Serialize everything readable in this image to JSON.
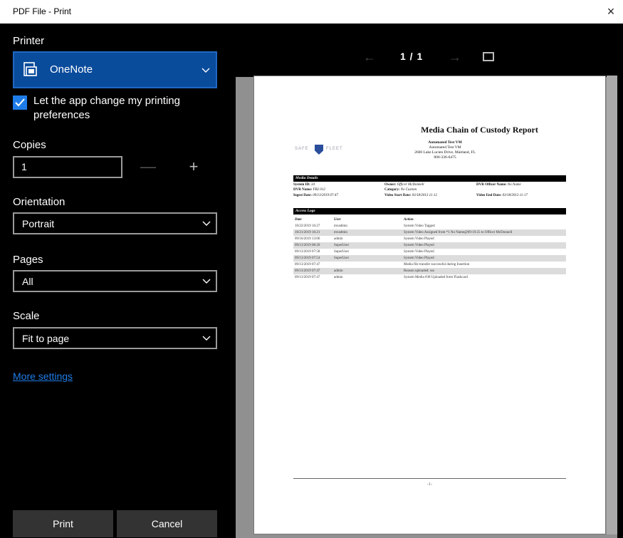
{
  "window": {
    "title": "PDF File - Print",
    "close_glyph": "×"
  },
  "printer": {
    "section_label": "Printer",
    "selected": "OneNote",
    "icon": "onenote-printer-icon",
    "accent": "#0a4c9c"
  },
  "app_prefs": {
    "checked": true,
    "label": "Let the app change my printing preferences"
  },
  "copies": {
    "label": "Copies",
    "value": "1",
    "minus": "—",
    "plus": "+"
  },
  "orientation": {
    "label": "Orientation",
    "selected": "Portrait"
  },
  "pages": {
    "label": "Pages",
    "selected": "All"
  },
  "scale": {
    "label": "Scale",
    "selected": "Fit to page"
  },
  "more_settings": "More settings",
  "buttons": {
    "print": "Print",
    "cancel": "Cancel"
  },
  "preview": {
    "prev_glyph": "←",
    "page_counter": "1 / 1",
    "next_glyph": "→",
    "fit_icon": "fit-page-icon"
  },
  "report": {
    "title": "Media Chain of Custody Report",
    "logo_left": "SAFE",
    "logo_right": "FLEET",
    "org_name": "Automated Test VM",
    "org_sub": "Automated Test VM",
    "org_address": "2600 Lake Lucien Drive, Maitland, FL",
    "org_phone": "800-336-6475",
    "media_details_header": "Media Details",
    "media": {
      "system_id_label": "System ID:",
      "system_id": "34",
      "owner_label": "Owner:",
      "owner": "Officer McDonnell",
      "dvr_officer_label": "DVR Officer Name:",
      "dvr_officer": "No Name",
      "dvr_name_label": "DVR Name:",
      "dvr_name": "FB2 012",
      "category_label": "Category:",
      "category": "No Custom",
      "ingest_label": "Ingest Date:",
      "ingest": "09/13/2019 07:47",
      "video_start_label": "Video Start Date:",
      "video_start": "03/18/2013 11:12",
      "video_end_label": "Video End Date:",
      "video_end": "03/18/2013 11:17"
    },
    "access_logs_header": "Access Logs",
    "columns": [
      "Date",
      "User",
      "Action"
    ],
    "rows": [
      {
        "date": "10/22/2019 16:27",
        "user": "mvadmin",
        "action": "System Video Tagged"
      },
      {
        "date": "10/21/2019 16:21",
        "user": "mvadmin",
        "action": "System Video Assigned from *1 No Name@09:19:25 to Officer McDonnell"
      },
      {
        "date": "09/16/2019 13:06",
        "user": "admin",
        "action": "System Video Played"
      },
      {
        "date": "09/13/2019 08:20",
        "user": "SuperUser",
        "action": "System Video Played"
      },
      {
        "date": "09/13/2019 07:58",
        "user": "SuperUser",
        "action": "System Video Played"
      },
      {
        "date": "09/13/2019 07:54",
        "user": "SuperUser",
        "action": "System Video Played"
      },
      {
        "date": "09/13/2019 07:47",
        "user": "",
        "action": "Media file transfer successful during Insertion"
      },
      {
        "date": "09/13/2019 07:47",
        "user": "admin",
        "action": "Reason uploaded: sss"
      },
      {
        "date": "09/13/2019 07:47",
        "user": "admin",
        "action": "System Media #38 Uploaded from Flashcard"
      }
    ],
    "page_footer": "-1-"
  }
}
